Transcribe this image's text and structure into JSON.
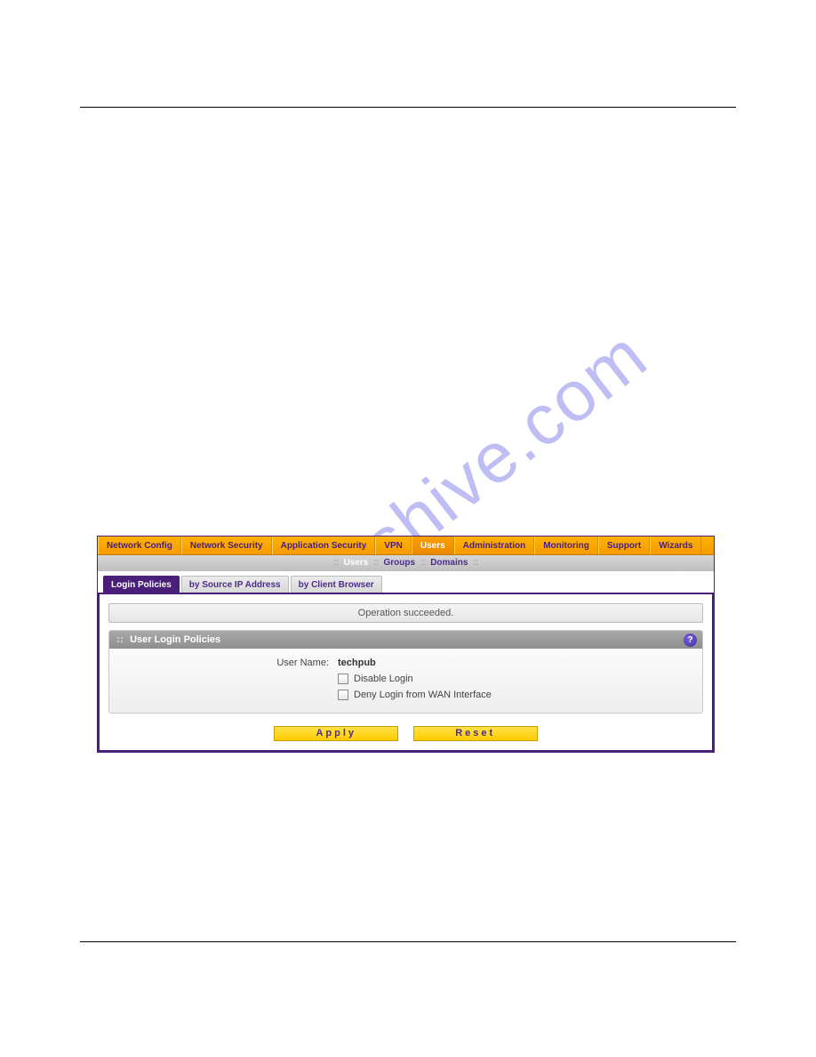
{
  "watermark": "manualshive.com",
  "nav": {
    "items": [
      {
        "label": "Network Config",
        "active": false
      },
      {
        "label": "Network Security",
        "active": false
      },
      {
        "label": "Application Security",
        "active": false
      },
      {
        "label": "VPN",
        "active": false
      },
      {
        "label": "Users",
        "active": true
      },
      {
        "label": "Administration",
        "active": false
      },
      {
        "label": "Monitoring",
        "active": false
      },
      {
        "label": "Support",
        "active": false
      },
      {
        "label": "Wizards",
        "active": false
      }
    ]
  },
  "subnav": {
    "items": [
      {
        "label": "Users",
        "active": true
      },
      {
        "label": "Groups",
        "active": false
      },
      {
        "label": "Domains",
        "active": false
      }
    ]
  },
  "tabs": [
    {
      "label": "Login Policies",
      "active": true
    },
    {
      "label": "by Source IP Address",
      "active": false
    },
    {
      "label": "by Client Browser",
      "active": false
    }
  ],
  "status_message": "Operation succeeded.",
  "panel": {
    "title": "User Login Policies",
    "help_glyph": "?",
    "username_label": "User Name:",
    "username_value": "techpub",
    "disable_login_label": "Disable Login",
    "deny_wan_label": "Deny Login from WAN Interface"
  },
  "buttons": {
    "apply": "Apply",
    "reset": "Reset"
  }
}
